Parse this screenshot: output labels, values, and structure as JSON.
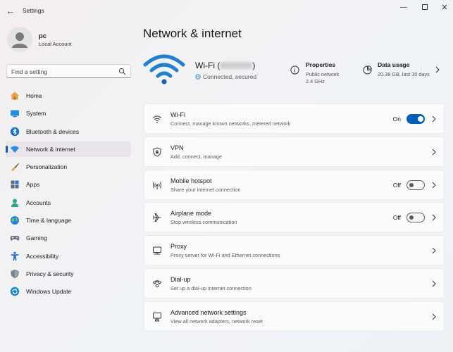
{
  "window": {
    "title": "Settings"
  },
  "user": {
    "name": "pc",
    "account_type": "Local Account"
  },
  "search": {
    "placeholder": "Find a setting"
  },
  "sidebar": {
    "items": [
      {
        "label": "Home",
        "icon": "home-icon"
      },
      {
        "label": "System",
        "icon": "system-icon"
      },
      {
        "label": "Bluetooth & devices",
        "icon": "bluetooth-icon"
      },
      {
        "label": "Network & internet",
        "icon": "network-icon",
        "selected": true
      },
      {
        "label": "Personalization",
        "icon": "brush-icon"
      },
      {
        "label": "Apps",
        "icon": "apps-icon"
      },
      {
        "label": "Accounts",
        "icon": "accounts-icon"
      },
      {
        "label": "Time & language",
        "icon": "globe-icon"
      },
      {
        "label": "Gaming",
        "icon": "gaming-icon"
      },
      {
        "label": "Accessibility",
        "icon": "accessibility-icon"
      },
      {
        "label": "Privacy & security",
        "icon": "shield-icon"
      },
      {
        "label": "Windows Update",
        "icon": "update-icon"
      }
    ]
  },
  "main": {
    "title": "Network & internet",
    "hero": {
      "name_prefix": "Wi-Fi (",
      "name_suffix": ")",
      "status": "Connected, secured",
      "properties": {
        "title": "Properties",
        "line1": "Public network",
        "line2": "2.4 GHz"
      },
      "data_usage": {
        "title": "Data usage",
        "line1": "20.38 GB, last 30 days"
      }
    },
    "cards": [
      {
        "title": "Wi-Fi",
        "subtitle": "Connect, manage known networks, metered network",
        "toggle": "On",
        "icon": "wifi-icon"
      },
      {
        "title": "VPN",
        "subtitle": "Add, connect, manage",
        "icon": "vpn-shield-icon"
      },
      {
        "title": "Mobile hotspot",
        "subtitle": "Share your internet connection",
        "toggle": "Off",
        "icon": "hotspot-icon"
      },
      {
        "title": "Airplane mode",
        "subtitle": "Stop wireless communication",
        "toggle": "Off",
        "icon": "airplane-icon"
      },
      {
        "title": "Proxy",
        "subtitle": "Proxy server for Wi-Fi and Ethernet connections",
        "icon": "proxy-icon"
      },
      {
        "title": "Dial-up",
        "subtitle": "Set up a dial-up internet connection",
        "icon": "dialup-icon"
      },
      {
        "title": "Advanced network settings",
        "subtitle": "View all network adapters, network reset",
        "icon": "advanced-network-icon"
      }
    ]
  },
  "colors": {
    "accent": "#005fb8",
    "selected_bg": "#e8e4e9"
  }
}
